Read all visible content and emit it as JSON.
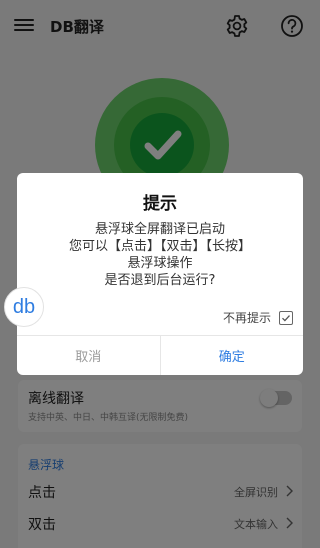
{
  "app": {
    "title": "DB翻译",
    "status": {
      "colors": {
        "outer": "#6dd26d",
        "middle": "#48c148",
        "inner": "#17a83b"
      }
    }
  },
  "offline": {
    "title": "离线翻译",
    "subtitle": "支持中英、中日、中韩互译(无限制免费)",
    "enabled": false
  },
  "floating_ball_section": {
    "title": "悬浮球",
    "rows": [
      {
        "label": "点击",
        "value": "全屏识别"
      },
      {
        "label": "双击",
        "value": "文本输入"
      }
    ]
  },
  "floating_ball": {
    "label": "db"
  },
  "dialog": {
    "title": "提示",
    "message_lines": [
      "悬浮球全屏翻译已启动",
      "您可以【点击】【双击】【长按】",
      "悬浮球操作",
      "是否退到后台运行?"
    ],
    "dont_remind_label": "不再提示",
    "dont_remind_checked": true,
    "cancel_label": "取消",
    "confirm_label": "确定"
  },
  "colors": {
    "accent": "#2f7de1",
    "overlay": "rgba(0,0,0,0.5)"
  }
}
